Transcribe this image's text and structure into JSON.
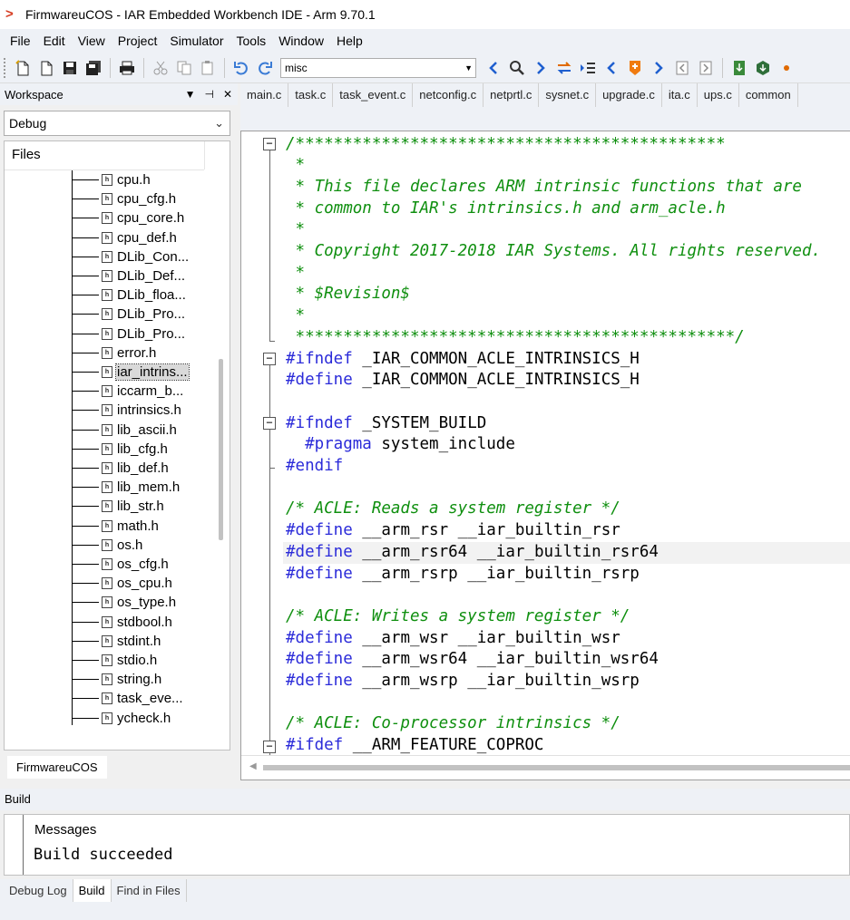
{
  "window": {
    "title": "FirmwareuCOS - IAR Embedded Workbench IDE - Arm 9.70.1"
  },
  "menu": [
    "File",
    "Edit",
    "View",
    "Project",
    "Simulator",
    "Tools",
    "Window",
    "Help"
  ],
  "toolbar": {
    "search_value": "misc"
  },
  "workspace": {
    "title": "Workspace",
    "configuration": "Debug",
    "files_header": "Files",
    "files": [
      "cpu.h",
      "cpu_cfg.h",
      "cpu_core.h",
      "cpu_def.h",
      "DLib_Con...",
      "DLib_Def...",
      "DLib_floa...",
      "DLib_Pro...",
      "DLib_Pro...",
      "error.h",
      "iar_intrins...",
      "iccarm_b...",
      "intrinsics.h",
      "lib_ascii.h",
      "lib_cfg.h",
      "lib_def.h",
      "lib_mem.h",
      "lib_str.h",
      "math.h",
      "os.h",
      "os_cfg.h",
      "os_cpu.h",
      "os_type.h",
      "stdbool.h",
      "stdint.h",
      "stdio.h",
      "string.h",
      "task_eve...",
      "ycheck.h"
    ],
    "selected_file": "iar_intrins...",
    "tab_label": "FirmwareuCOS"
  },
  "editor": {
    "tabs": [
      "main.c",
      "task.c",
      "task_event.c",
      "netconfig.c",
      "netprtl.c",
      "sysnet.c",
      "upgrade.c",
      "ita.c",
      "ups.c",
      "common"
    ],
    "code": [
      [
        {
          "c": "cmt",
          "t": "/*********************************************"
        }
      ],
      [
        {
          "c": "cmt",
          "t": " *"
        }
      ],
      [
        {
          "c": "cmt",
          "t": " * This file declares ARM intrinsic functions that are"
        }
      ],
      [
        {
          "c": "cmt",
          "t": " * common to IAR's intrinsics.h and arm_acle.h"
        }
      ],
      [
        {
          "c": "cmt",
          "t": " *"
        }
      ],
      [
        {
          "c": "cmt",
          "t": " * Copyright 2017-2018 IAR Systems. All rights reserved."
        }
      ],
      [
        {
          "c": "cmt",
          "t": " *"
        }
      ],
      [
        {
          "c": "cmt",
          "t": " * $Revision$"
        }
      ],
      [
        {
          "c": "cmt",
          "t": " *"
        }
      ],
      [
        {
          "c": "cmt",
          "t": " **********************************************/"
        }
      ],
      [
        {
          "c": "pp",
          "t": "#ifndef"
        },
        {
          "c": "id",
          "t": " _IAR_COMMON_ACLE_INTRINSICS_H"
        }
      ],
      [
        {
          "c": "pp",
          "t": "#define"
        },
        {
          "c": "id",
          "t": " _IAR_COMMON_ACLE_INTRINSICS_H"
        }
      ],
      [],
      [
        {
          "c": "pp",
          "t": "#ifndef"
        },
        {
          "c": "id",
          "t": " _SYSTEM_BUILD"
        }
      ],
      [
        {
          "c": "pp",
          "t": "  #pragma"
        },
        {
          "c": "id",
          "t": " system_include"
        }
      ],
      [
        {
          "c": "pp",
          "t": "#endif"
        }
      ],
      [],
      [
        {
          "c": "cmt",
          "t": "/* ACLE: Reads a system register */"
        }
      ],
      [
        {
          "c": "pp",
          "t": "#define"
        },
        {
          "c": "id",
          "t": " __arm_rsr __iar_builtin_rsr"
        }
      ],
      [
        {
          "c": "pp",
          "t": "#define"
        },
        {
          "c": "id",
          "t": " __arm_rsr64 __iar_builtin_rsr64"
        }
      ],
      [
        {
          "c": "pp",
          "t": "#define"
        },
        {
          "c": "id",
          "t": " __arm_rsrp __iar_builtin_rsrp"
        }
      ],
      [],
      [
        {
          "c": "cmt",
          "t": "/* ACLE: Writes a system register */"
        }
      ],
      [
        {
          "c": "pp",
          "t": "#define"
        },
        {
          "c": "id",
          "t": " __arm_wsr __iar_builtin_wsr"
        }
      ],
      [
        {
          "c": "pp",
          "t": "#define"
        },
        {
          "c": "id",
          "t": " __arm_wsr64 __iar_builtin_wsr64"
        }
      ],
      [
        {
          "c": "pp",
          "t": "#define"
        },
        {
          "c": "id",
          "t": " __arm_wsrp __iar_builtin_wsrp"
        }
      ],
      [],
      [
        {
          "c": "cmt",
          "t": "/* ACLE: Co-processor intrinsics */"
        }
      ],
      [
        {
          "c": "pp",
          "t": "#ifdef"
        },
        {
          "c": "id",
          "t": " __ARM_FEATURE_COPROC"
        }
      ]
    ]
  },
  "build": {
    "title": "Build",
    "messages_header": "Messages",
    "message": "Build succeeded",
    "tabs": [
      "Debug Log",
      "Build",
      "Find in Files"
    ],
    "active_tab": "Build"
  }
}
